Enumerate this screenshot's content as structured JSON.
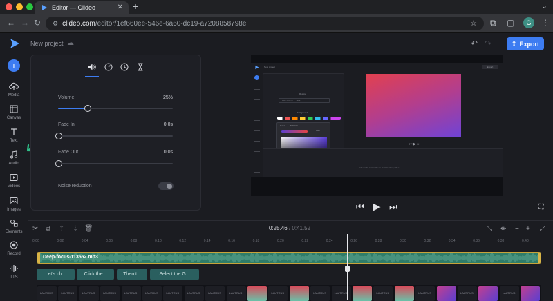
{
  "browser": {
    "tab_title": "Editor — Clideo",
    "url_host": "clideo.com",
    "url_path": "/editor/1ef660ee-546e-6a60-dc19-a7208858798e",
    "profile_initial": "G"
  },
  "header": {
    "project_name": "New project",
    "export_label": "Export"
  },
  "sidebar": {
    "items": [
      {
        "label": "Media",
        "icon": "cloud-upload-icon"
      },
      {
        "label": "Canvas",
        "icon": "canvas-icon"
      },
      {
        "label": "Text",
        "icon": "text-icon"
      },
      {
        "label": "Audio",
        "icon": "music-note-icon"
      },
      {
        "label": "Videos",
        "icon": "video-icon"
      },
      {
        "label": "Images",
        "icon": "image-icon"
      },
      {
        "label": "Elements",
        "icon": "elements-icon"
      },
      {
        "label": "Record",
        "icon": "record-icon"
      },
      {
        "label": "TTS",
        "icon": "tts-icon"
      }
    ]
  },
  "audio_panel": {
    "tabs": [
      "volume-icon",
      "speed-icon",
      "clock-icon",
      "hourglass-icon"
    ],
    "volume": {
      "label": "Volume",
      "value": "25%",
      "level": 0.25
    },
    "fade_in": {
      "label": "Fade In",
      "value": "0.0s",
      "level": 0
    },
    "fade_out": {
      "label": "Fade Out",
      "value": "0.0s",
      "level": 0
    },
    "noise_reduction": {
      "label": "Noise reduction",
      "enabled": false
    }
  },
  "preview": {
    "mini_project": "New project",
    "mini_export": "Export",
    "mini_colorpicker_tab1": "Solid",
    "mini_colorpicker_tab2": "Gradient",
    "mini_colorpicker_hex": "HEX",
    "mini_canvas_label": "Resize",
    "mini_canvas_select": "Widescreen — 16:9",
    "mini_background_label": "Background",
    "mini_timeline_hint": "Add media to timeline to start creating video"
  },
  "timeline": {
    "current_time": "0:25.46",
    "total_time": "0:41.52",
    "ticks": [
      "0:00",
      "0:02",
      "0:04",
      "0:06",
      "0:08",
      "0:10",
      "0:12",
      "0:14",
      "0:16",
      "0:18",
      "0:20",
      "0:22",
      "0:24",
      "0:26",
      "0:28",
      "0:30",
      "0:32",
      "0:34",
      "0:36",
      "0:38",
      "0:40"
    ],
    "audio_clip": "Deep-focus-113552.mp3",
    "text_clips": [
      "Let's ch...",
      "Click the...",
      "Then t...",
      "Select the G..."
    ],
    "video_label": "LAUTRUS"
  },
  "colors": {
    "accent": "#3d7cf1",
    "audio_clip": "#2f7c68",
    "text_clip": "#2a5f5f",
    "arrow": "#2fbf88"
  }
}
